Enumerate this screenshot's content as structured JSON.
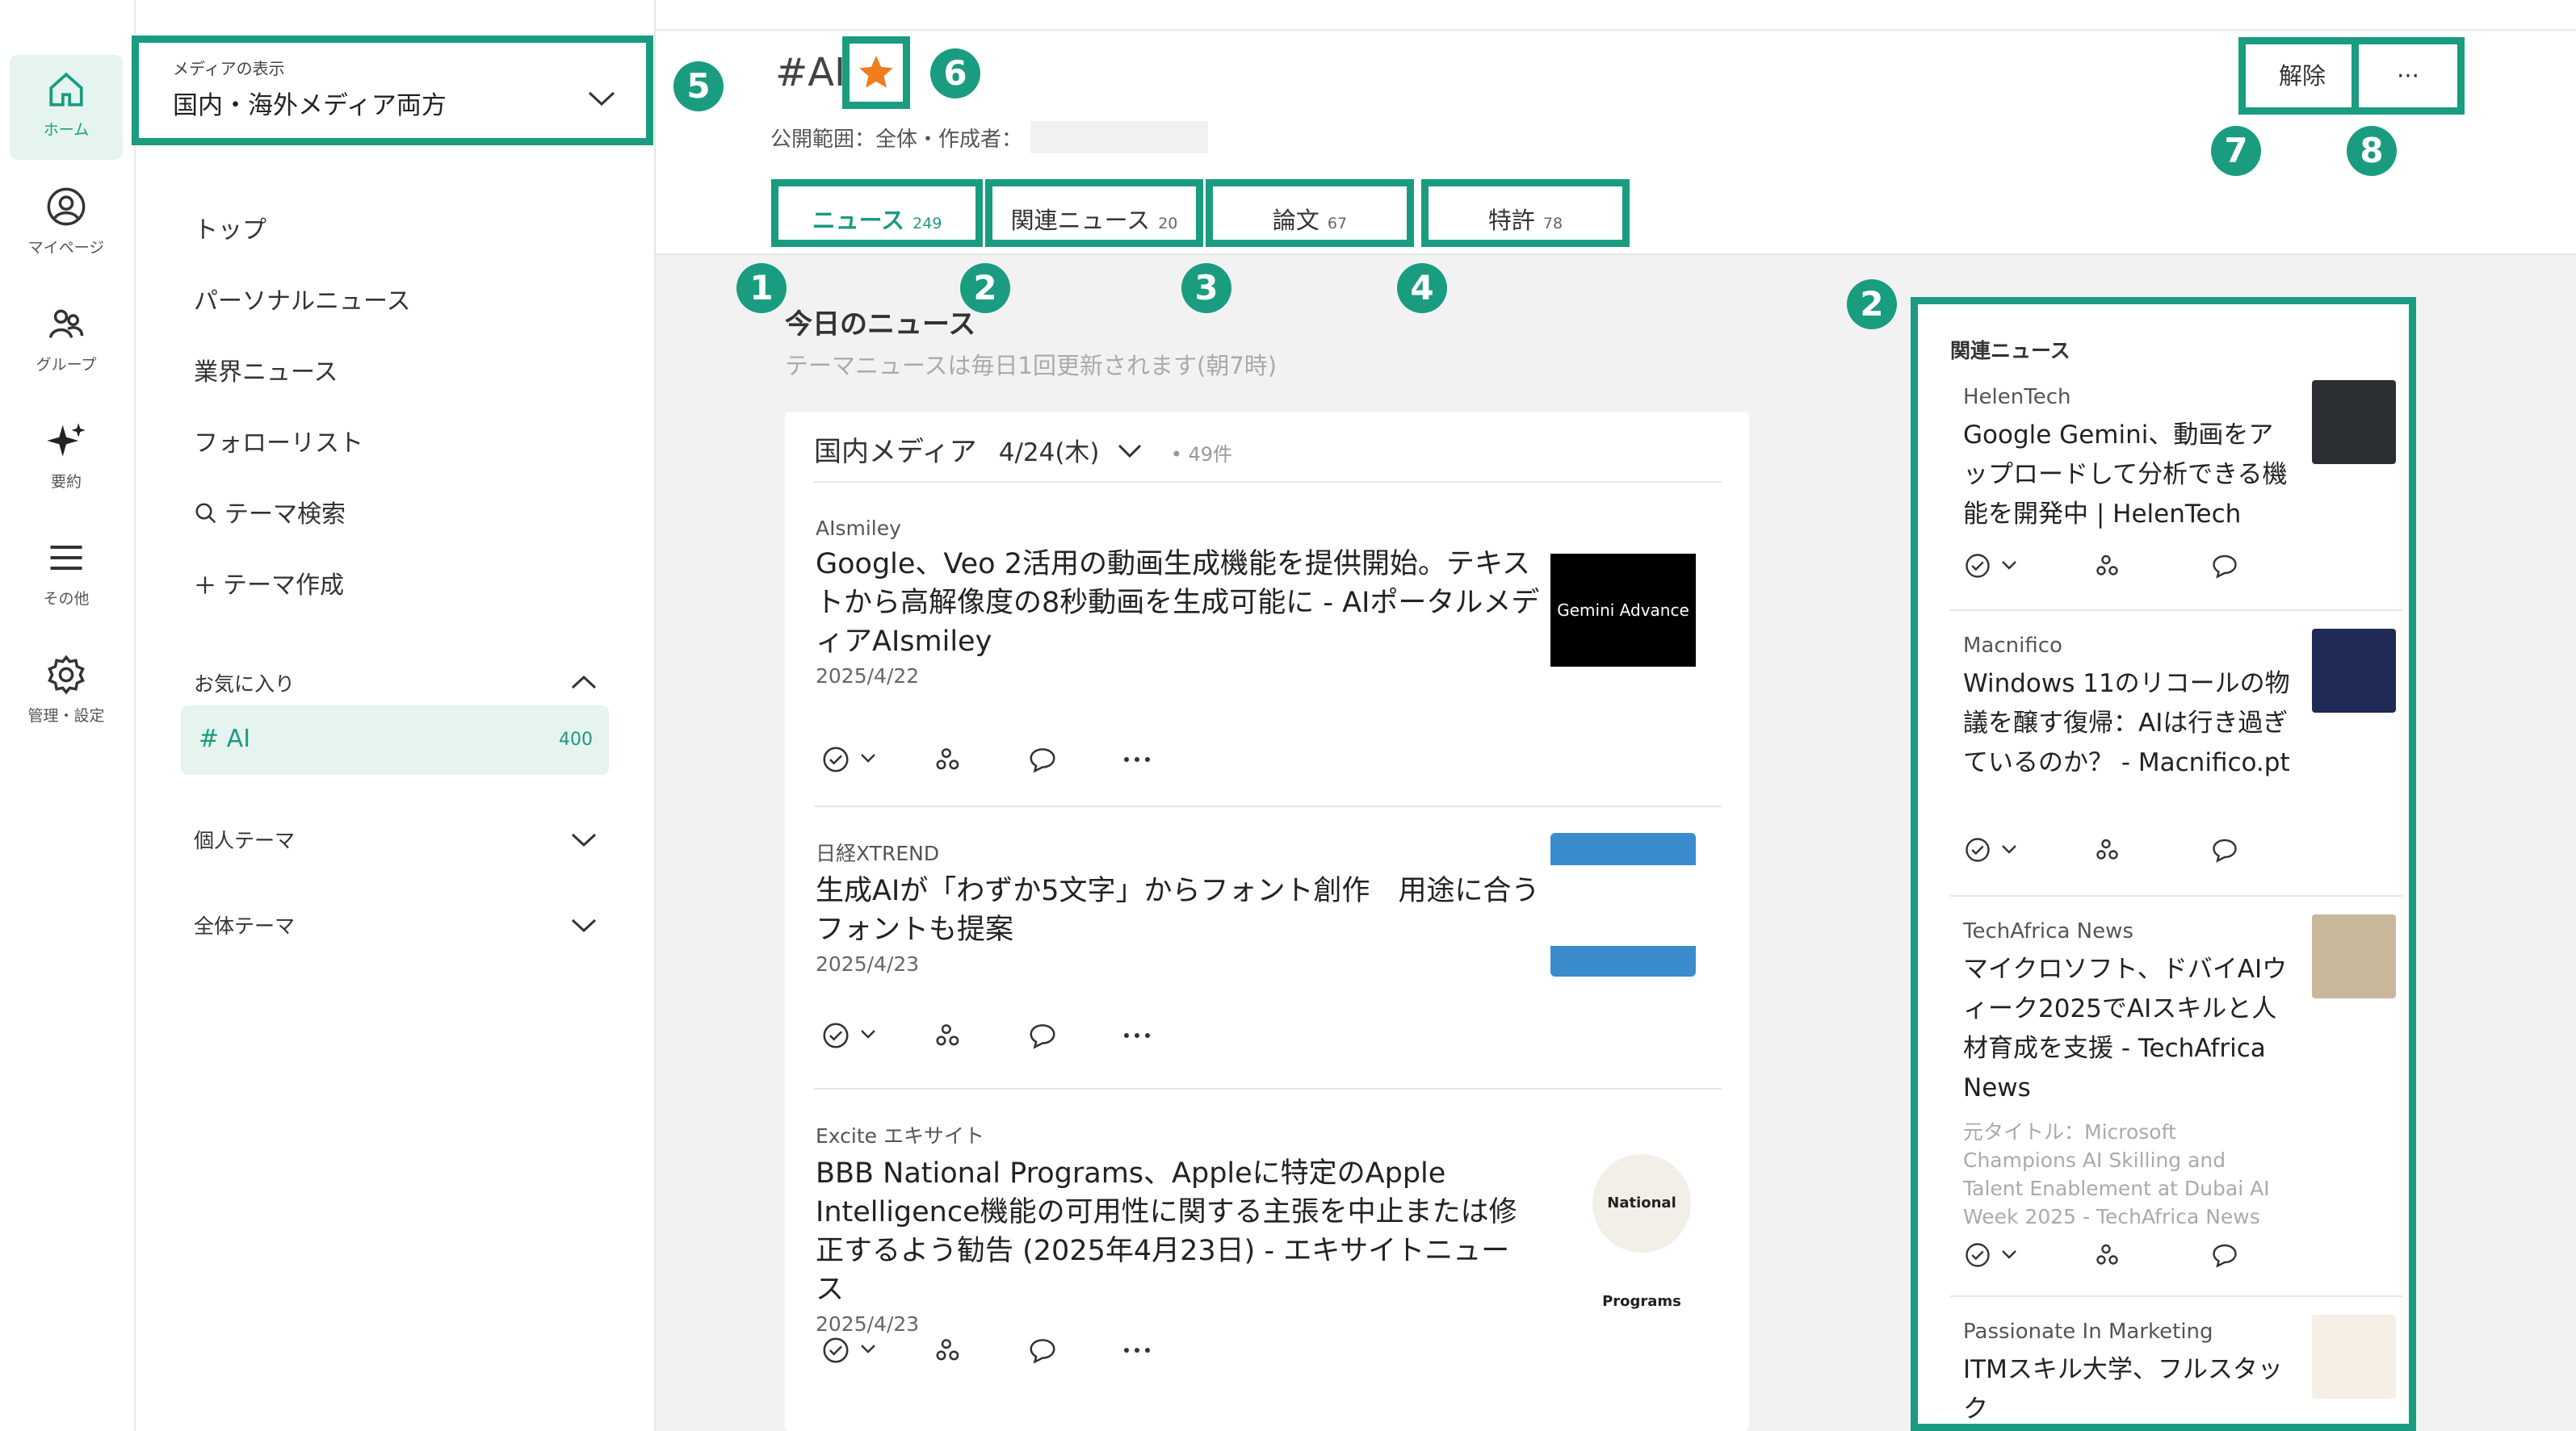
{
  "rail": {
    "items": [
      {
        "label": "ホーム"
      },
      {
        "label": "マイページ"
      },
      {
        "label": "グループ"
      },
      {
        "label": "要約"
      },
      {
        "label": "その他"
      },
      {
        "label": "管理・設定"
      }
    ]
  },
  "media_select": {
    "caption": "メディアの表示",
    "value": "国内・海外メディア両方"
  },
  "sidebar": {
    "nav": [
      "トップ",
      "パーソナルニュース",
      "業界ニュース",
      "フォローリスト",
      "テーマ検索",
      "テーマ作成"
    ],
    "favorites_label": "お気に入り",
    "favorite_item": {
      "label": "# AI",
      "count": "400"
    },
    "personal_label": "個人テーマ",
    "all_label": "全体テーマ"
  },
  "header": {
    "title": "#AI",
    "meta": "公開範囲：全体・作成者：",
    "unfollow_label": "解除",
    "more_label": "···"
  },
  "tabs": [
    {
      "label": "ニュース",
      "count": "249"
    },
    {
      "label": "関連ニュース",
      "count": "20"
    },
    {
      "label": "論文",
      "count": "67"
    },
    {
      "label": "特許",
      "count": "78"
    }
  ],
  "today": {
    "heading": "今日のニュース",
    "sub": "テーマニュースは毎日1回更新されます(朝7時)"
  },
  "feed": {
    "media_label": "国内メディア",
    "date": "4/24(木)",
    "count": "• 49件",
    "articles": [
      {
        "source": "AIsmiley",
        "title": "Google、Veo 2活用の動画生成機能を提供開始。テキストから高解像度の8秒動画を生成可能に - AIポータルメディアAIsmiley",
        "date": "2025/4/22",
        "thumb_text": "Gemini Advance"
      },
      {
        "source": "日経XTREND",
        "title": "生成AIが「わずか5文字」からフォント創作　用途に合うフォントも提案",
        "date": "2025/4/23",
        "thumb_text": ""
      },
      {
        "source": "Excite エキサイト",
        "title": "BBB National Programs、Appleに特定のApple Intelligence機能の可用性に関する主張を中止または修正するよう勧告 (2025年4月23日) - エキサイトニュース",
        "date": "2025/4/23",
        "thumb_text": "National Programs"
      }
    ]
  },
  "related": {
    "heading": "関連ニュース",
    "items": [
      {
        "source": "HelenTech",
        "title": "Google Gemini、動画をアップロードして分析できる機能を開発中 | HelenTech",
        "sub": ""
      },
      {
        "source": "Macnifico",
        "title": "Windows 11のリコールの物議を醸す復帰：AIは行き過ぎているのか？ - Macnifico.pt",
        "sub": ""
      },
      {
        "source": "TechAfrica News",
        "title": "マイクロソフト、ドバイAIウィーク2025でAIスキルと人材育成を支援 - TechAfrica News",
        "sub": "元タイトル：Microsoft Champions AI Skilling and Talent Enablement at Dubai AI Week 2025 - TechAfrica News"
      },
      {
        "source": "Passionate In Marketing",
        "title": "ITMスキル大学、フルスタック",
        "sub": ""
      }
    ]
  },
  "callouts": [
    "1",
    "2",
    "3",
    "4",
    "5",
    "6",
    "7",
    "8",
    "2"
  ],
  "colors": {
    "accent": "#1a9c80",
    "star": "#f07c1e",
    "fav_bg": "#e6f4ef"
  }
}
